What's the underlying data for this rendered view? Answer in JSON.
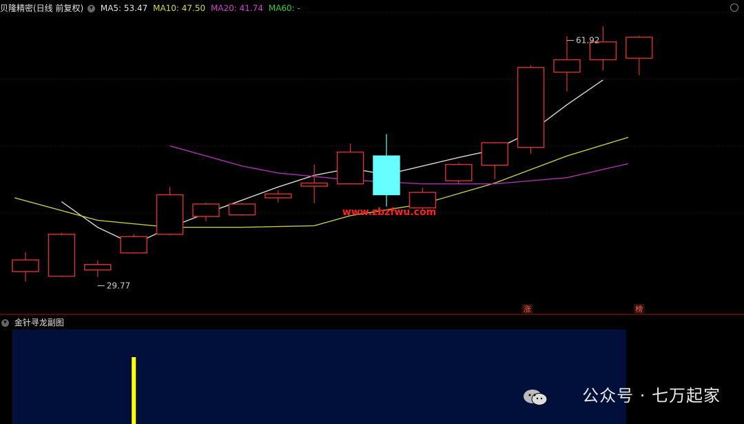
{
  "header": {
    "title": "贝隆精密(日线 前复权)",
    "ma5_label": "MA5: 53.47",
    "ma10_label": "MA10: 47.50",
    "ma20_label": "MA20: 41.74",
    "ma60_label": "MA60: -"
  },
  "sub_panel": {
    "title": "金针寻龙副图"
  },
  "watermark": {
    "text": "公众号 · 七万起家"
  },
  "site_watermark": "www.zbzfwu.com",
  "colors": {
    "up": "#e03030",
    "down": "#66ffff",
    "ma5": "#d8d8d8",
    "ma10": "#c8c832",
    "ma20": "#b030b0",
    "ma60": "#30c030",
    "sub_bg": "#00103a",
    "signal": "#ffff00"
  },
  "chart_data": {
    "type": "candlestick",
    "ylim": [
      27.5,
      65
    ],
    "candles": [
      {
        "o": 31.6,
        "c": 33.1,
        "h": 34.1,
        "l": 30.3
      },
      {
        "o": 31.0,
        "c": 36.4,
        "h": 36.6,
        "l": 30.9
      },
      {
        "o": 31.8,
        "c": 32.5,
        "h": 33.0,
        "l": 30.9
      },
      {
        "o": 34.0,
        "c": 36.1,
        "h": 36.4,
        "l": 33.9
      },
      {
        "o": 36.4,
        "c": 41.5,
        "h": 42.5,
        "l": 36.3
      },
      {
        "o": 38.7,
        "c": 40.3,
        "h": 40.5,
        "l": 38.1
      },
      {
        "o": 38.9,
        "c": 40.3,
        "h": 40.4,
        "l": 38.8
      },
      {
        "o": 41.1,
        "c": 41.6,
        "h": 42.1,
        "l": 40.5
      },
      {
        "o": 42.6,
        "c": 43.0,
        "h": 45.4,
        "l": 40.4
      },
      {
        "o": 42.9,
        "c": 47.0,
        "h": 48.1,
        "l": 42.9
      },
      {
        "o": 46.5,
        "c": 41.5,
        "h": 49.3,
        "l": 40.0
      },
      {
        "o": 39.8,
        "c": 41.8,
        "h": 42.4,
        "l": 39.6
      },
      {
        "o": 43.3,
        "c": 45.4,
        "h": 45.6,
        "l": 42.9
      },
      {
        "o": 45.3,
        "c": 48.2,
        "h": 48.3,
        "l": 43.5
      },
      {
        "o": 47.6,
        "c": 57.9,
        "h": 58.2,
        "l": 46.8
      },
      {
        "o": 57.3,
        "c": 58.9,
        "h": 61.92,
        "l": 54.8
      },
      {
        "o": 58.9,
        "c": 61.2,
        "h": 63.2,
        "l": 57.5
      },
      {
        "o": 59.1,
        "c": 61.8,
        "h": 62.0,
        "l": 56.9
      }
    ],
    "ma5": [
      null,
      40.6,
      37.3,
      35.1,
      37.3,
      39.1,
      40.8,
      42.5,
      44.0,
      44.9,
      44.1,
      45.2,
      46.3,
      47.3,
      49.6,
      53.1,
      56.3
    ],
    "ma10": [
      [
        -0.3,
        41.1
      ],
      [
        2,
        38.2
      ],
      [
        4,
        37.3
      ],
      [
        6,
        37.3
      ],
      [
        8,
        37.5
      ],
      [
        9,
        38.8
      ],
      [
        11,
        40.3
      ],
      [
        13,
        43.0
      ],
      [
        15,
        46.5
      ],
      [
        16.7,
        48.9
      ]
    ],
    "ma20": [
      [
        4,
        47.8
      ],
      [
        6,
        45.2
      ],
      [
        7,
        44.3
      ],
      [
        9,
        43.4
      ],
      [
        11,
        42.9
      ],
      [
        13,
        42.9
      ],
      [
        15,
        43.7
      ],
      [
        16.7,
        45.5
      ]
    ],
    "ma60": [],
    "markers": [
      {
        "index": 15,
        "price": 61.92,
        "label": "61.92"
      },
      {
        "index": 2,
        "price": 30.3,
        "label": "29.77"
      }
    ],
    "tags": [
      {
        "index": 13.9,
        "label": "涨"
      },
      {
        "index": 17,
        "label": "榜"
      }
    ],
    "sub_signals": [
      3
    ]
  }
}
